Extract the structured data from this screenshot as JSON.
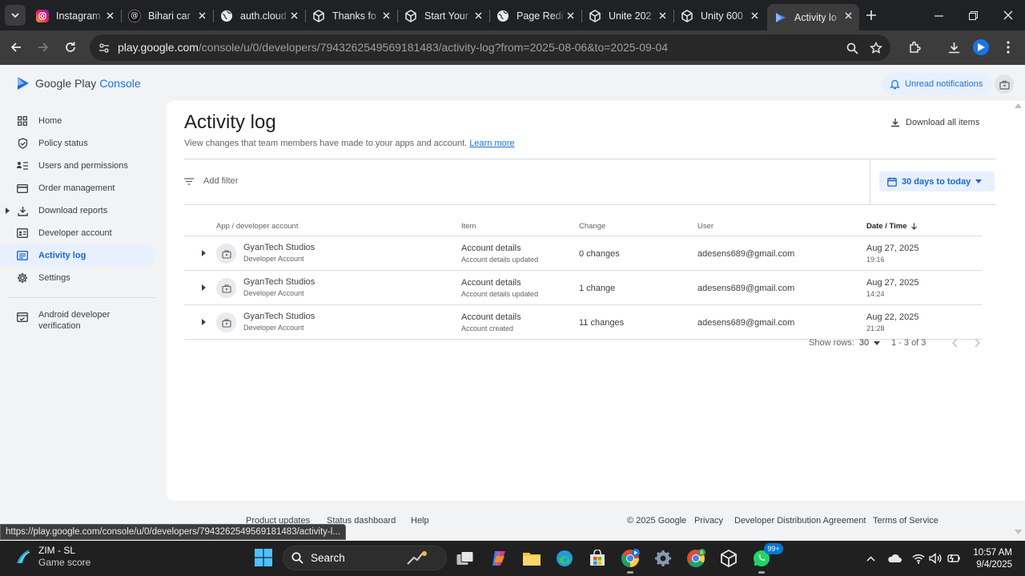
{
  "browser": {
    "tabs": [
      {
        "title": "Instagram"
      },
      {
        "title": "Bihari car"
      },
      {
        "title": "auth.cloud"
      },
      {
        "title": "Thanks fo"
      },
      {
        "title": "Start Your"
      },
      {
        "title": "Page Redi"
      },
      {
        "title": "Unite 202"
      },
      {
        "title": "Unity 600"
      },
      {
        "title": "Activity lo"
      }
    ],
    "url_host": "play.google.com",
    "url_path": "/console/u/0/developers/7943262549569181483/activity-log?from=2025-08-06&to=2025-09-04",
    "status_url": "https://play.google.com/console/u/0/developers/7943262549569181483/activity-l..."
  },
  "console": {
    "logo_text": "Google Play",
    "logo_text2": "Console",
    "notifications_label": "Unread notifications",
    "nav": [
      {
        "label": "Home",
        "icon": "home-grid-icon"
      },
      {
        "label": "Policy status",
        "icon": "shield-icon"
      },
      {
        "label": "Users and permissions",
        "icon": "users-list-icon"
      },
      {
        "label": "Order management",
        "icon": "card-icon"
      },
      {
        "label": "Download reports",
        "icon": "download-icon"
      },
      {
        "label": "Developer account",
        "icon": "id-card-icon"
      },
      {
        "label": "Activity log",
        "icon": "activity-log-icon"
      },
      {
        "label": "Settings",
        "icon": "gear-icon"
      },
      {
        "label": "Android developer\nverification",
        "icon": "verification-icon"
      }
    ],
    "page_title": "Activity log",
    "subtitle": "View changes that team members have made to your apps and account.",
    "learn_more": "Learn more",
    "download_all": "Download all items",
    "add_filter": "Add filter",
    "date_range": "30 days to today",
    "columns": {
      "app": "App / developer account",
      "item": "Item",
      "change": "Change",
      "user": "User",
      "date": "Date / Time"
    },
    "rows": [
      {
        "app": "GyanTech Studios",
        "app_type": "Developer Account",
        "item": "Account details",
        "item_sub": "Account details updated",
        "change": "0 changes",
        "user": "adesens689@gmail.com",
        "date": "Aug 27, 2025",
        "time": "19:16"
      },
      {
        "app": "GyanTech Studios",
        "app_type": "Developer Account",
        "item": "Account details",
        "item_sub": "Account details updated",
        "change": "1 change",
        "user": "adesens689@gmail.com",
        "date": "Aug 27, 2025",
        "time": "14:24"
      },
      {
        "app": "GyanTech Studios",
        "app_type": "Developer Account",
        "item": "Account details",
        "item_sub": "Account created",
        "change": "11 changes",
        "user": "adesens689@gmail.com",
        "date": "Aug 22, 2025",
        "time": "21:28"
      }
    ],
    "show_rows_label": "Show rows:",
    "show_rows_value": "30",
    "range_label": "1 - 3 of 3",
    "footer": {
      "product_updates": "Product updates",
      "status_dashboard": "Status dashboard",
      "help": "Help",
      "copyright": "© 2025 Google",
      "privacy": "Privacy",
      "dda": "Developer Distribution Agreement",
      "tos": "Terms of Service"
    }
  },
  "taskbar": {
    "weather_title": "ZIM - SL",
    "weather_sub": "Game score",
    "search_label": "Search",
    "whatsapp_badge": "99+",
    "time": "10:57 AM",
    "date": "9/4/2025"
  },
  "colors": {
    "accent": "#1a73e8",
    "active_nav_bg": "#e8f0fe",
    "chrome_dark": "#202124",
    "chrome_toolbar": "#3c3c3c"
  }
}
